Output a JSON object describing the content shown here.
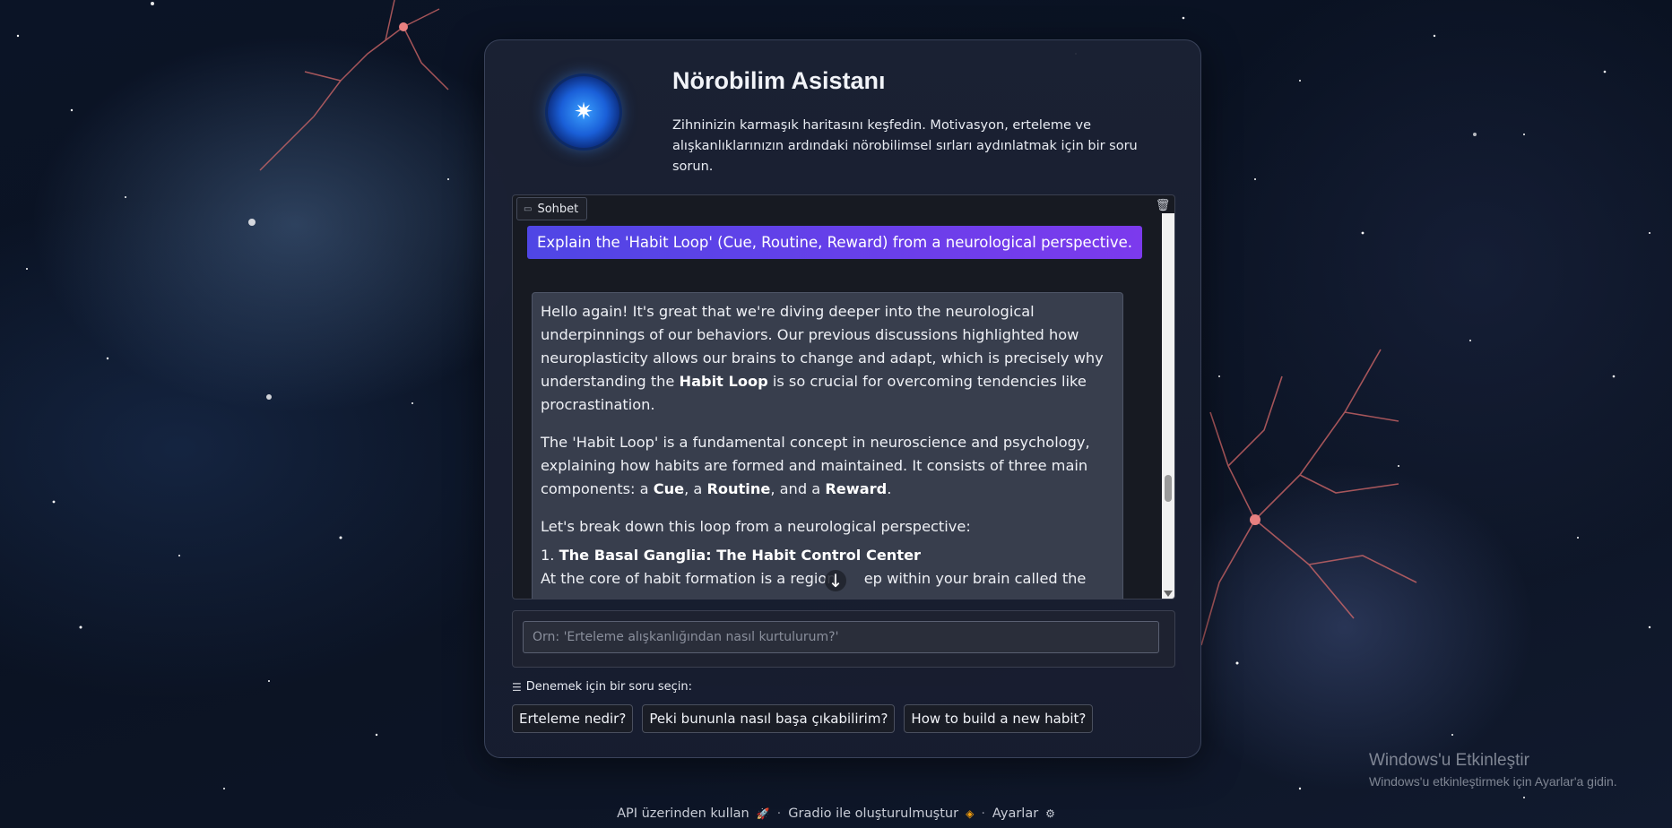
{
  "header": {
    "title": "Nörobilim Asistanı",
    "subtitle": "Zihninizin karmaşık haritasını keşfedin. Motivasyon, erteleme ve alışkanlıklarınızın ardındaki nörobilimsel sırları aydınlatmak için bir soru sorun.",
    "logo_icon": "star-icon"
  },
  "chat": {
    "label": "Sohbet",
    "label_icon": "chat-icon",
    "clear_icon": "trash-icon",
    "user_message": "Explain the 'Habit Loop' (Cue, Routine, Reward) from a neurological perspective.",
    "bot_message": {
      "p1_a": "Hello again! It's great that we're diving deeper into the neurological underpinnings of our behaviors. Our previous discussions highlighted how neuroplasticity allows our brains to change and adapt, which is precisely why understanding the ",
      "p1_bold": "Habit Loop",
      "p1_b": " is so crucial for overcoming tendencies like procrastination.",
      "p2_a": "The 'Habit Loop' is a fundamental concept in neuroscience and psychology, explaining how habits are formed and maintained. It consists of three main components: a ",
      "p2_cue": "Cue",
      "p2_sep1": ", a ",
      "p2_routine": "Routine",
      "p2_sep2": ", and a ",
      "p2_reward": "Reward",
      "p2_end": ".",
      "p3": "Let's break down this loop from a neurological perspective:",
      "list_num": "1. ",
      "list_title": "The Basal Ganglia: The Habit Control Center",
      "list_text_a": "At the core of habit formation is a region ",
      "list_text_b": "ep within your brain called the"
    },
    "scroll_down_icon": "arrow-down-icon"
  },
  "input": {
    "placeholder": "Örn: 'Erteleme alışkanlığından nasıl kurtulurum?'",
    "value": ""
  },
  "examples": {
    "label": "Denemek için bir soru seçin:",
    "label_icon": "list-icon",
    "items": [
      "Erteleme nedir?",
      "Peki bununla nasıl başa çıkabilirim?",
      "How to build a new habit?"
    ]
  },
  "footer": {
    "api": "API üzerinden kullan",
    "built": "Gradio ile oluşturulmuştur",
    "settings": "Ayarlar",
    "separator": "·"
  },
  "windows_activation": {
    "line1": "Windows'u Etkinleştir",
    "line2": "Windows'u etkinleştirmek için Ayarlar'a gidin."
  },
  "colors": {
    "user_bubble_start": "#4f46e5",
    "user_bubble_end": "#7c3aed",
    "bot_bubble": "#383e4d",
    "card_bg": "#1c2234"
  }
}
